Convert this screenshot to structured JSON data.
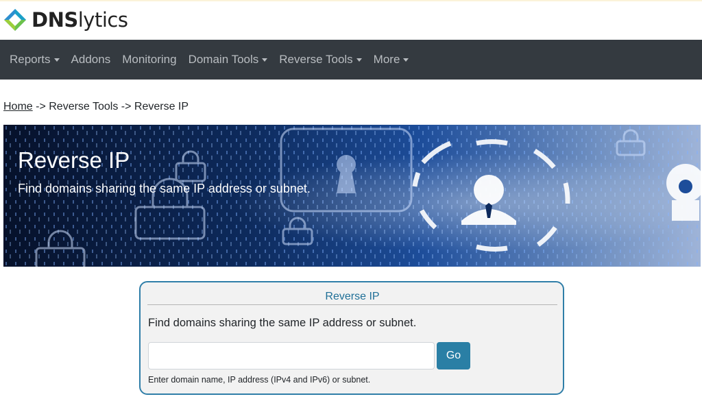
{
  "brand": {
    "name_bold": "DNS",
    "name_rest": "lytics"
  },
  "nav": {
    "items": [
      {
        "label": "Reports",
        "dropdown": true
      },
      {
        "label": "Addons",
        "dropdown": false
      },
      {
        "label": "Monitoring",
        "dropdown": false
      },
      {
        "label": "Domain Tools",
        "dropdown": true
      },
      {
        "label": "Reverse Tools",
        "dropdown": true
      },
      {
        "label": "More",
        "dropdown": true
      }
    ]
  },
  "breadcrumb": {
    "home": "Home",
    "separator": " -> ",
    "crumb1": "Reverse Tools",
    "crumb2": "Reverse IP"
  },
  "hero": {
    "title": "Reverse IP",
    "subtitle": "Find domains sharing the same IP address or subnet."
  },
  "form": {
    "title": "Reverse IP",
    "description": "Find domains sharing the same IP address or subnet.",
    "input_value": "",
    "input_placeholder": "",
    "button_label": "Go",
    "help_text": "Enter domain name, IP address (IPv4 and IPv6) or subnet."
  },
  "colors": {
    "navbar_bg": "#343a40",
    "accent": "#2a7fa5",
    "card_border": "#2f7ea8"
  }
}
